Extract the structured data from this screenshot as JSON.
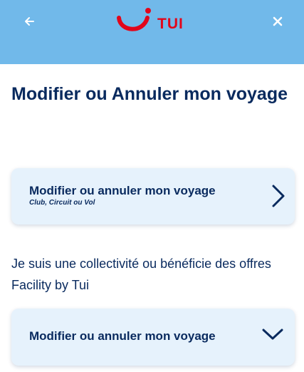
{
  "header": {
    "back_icon": "arrow-left-icon",
    "close_icon": "close-icon",
    "logo_text": "TUI",
    "colors": {
      "background": "#71b9ea",
      "logo": "#e2061b"
    }
  },
  "main": {
    "title": "Modifier ou Annuler mon voyage",
    "cards": [
      {
        "title": "Modifier ou annuler mon voyage",
        "subtitle": "Club, Circuit ou Vol",
        "icon": "chevron-right-icon"
      },
      {
        "title": "Modifier ou annuler mon voyage",
        "icon": "chevron-down-icon"
      }
    ],
    "section_text": "Je suis une collectivité ou bénéficie des offres Facility by Tui"
  },
  "colors": {
    "text": "#092a5e",
    "card_bg": "#e6f2fc"
  }
}
